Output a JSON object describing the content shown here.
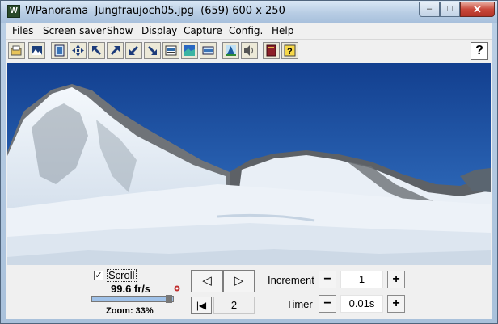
{
  "window": {
    "title": "WPanorama  Jungfraujoch05.jpg  (659) 600 x 250",
    "app_icon": "wpanorama-app-icon",
    "controls": {
      "minimize_glyph": "–",
      "maximize_glyph": "□",
      "close_glyph": "✕"
    }
  },
  "menu": [
    "Files",
    "Screen saver",
    "Show",
    "Display",
    "Capture",
    "Config.",
    "Help"
  ],
  "toolbar": {
    "buttons": [
      "open-file-icon",
      "picture-icon",
      "fullscreen-icon",
      "move-icon",
      "arrow-up-left-icon",
      "arrow-up-right-icon",
      "arrow-down-left-icon",
      "arrow-down-right-icon",
      "panorama-strip-icon",
      "landscape-icon",
      "fit-height-icon",
      "spotlight-icon",
      "speaker-icon",
      "book-icon",
      "context-help-icon"
    ],
    "help_label": "?"
  },
  "viewer": {
    "image_name": "Jungfraujoch05.jpg",
    "sky_color": "#1c4fa0",
    "snow_color": "#f2f6fb"
  },
  "controls": {
    "scroll_label": "Scroll",
    "scroll_checked": true,
    "check_glyph": "✓",
    "speed": "99.6 fr/s",
    "zoom": "Zoom: 33%",
    "speed_slider_fraction": 0.9,
    "prev_glyph": "◁",
    "next_glyph": "▷",
    "first_glyph": "|◀",
    "frame_value": "2",
    "increment_label": "Increment",
    "increment_value": "1",
    "timer_label": "Timer",
    "timer_value": "0.01s",
    "minus_glyph": "−",
    "plus_glyph": "+"
  }
}
